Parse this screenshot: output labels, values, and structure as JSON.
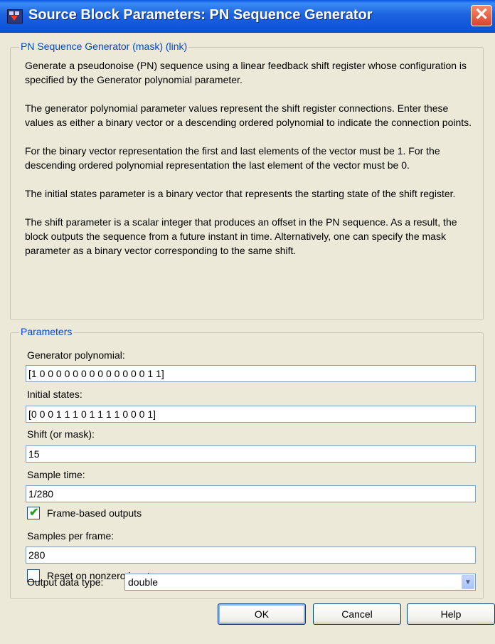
{
  "window": {
    "title": "Source Block Parameters: PN Sequence Generator",
    "close_glyph": "✕",
    "icon": "simulink-block-icon"
  },
  "description": {
    "legend": "PN Sequence Generator (mask) (link)",
    "paragraphs": [
      "Generate a pseudonoise (PN) sequence using a linear feedback shift register whose configuration is specified by the Generator polynomial parameter.",
      "The generator polynomial parameter values represent the shift register connections. Enter these values as either a binary vector or a descending ordered polynomial to indicate the connection points.",
      "For the binary vector representation the first and last elements of the vector must be 1. For the descending ordered polynomial representation the last element of the vector must be 0.",
      "The initial states parameter is a binary vector that represents the starting state of the shift register.",
      "The shift parameter is a scalar integer that produces an offset in the PN sequence. As a result, the block outputs the sequence from a future instant in time. Alternatively, one can specify the mask parameter as a binary vector corresponding to the same shift."
    ]
  },
  "parameters": {
    "legend": "Parameters",
    "generator_polynomial": {
      "label": "Generator polynomial:",
      "value": "[1 0 0 0 0 0 0 0 0 0 0 0 0 0 1 1]"
    },
    "initial_states": {
      "label": "Initial states:",
      "value": "[0 0 0 1 1 1 0 1 1 1 1 0 0 0 1]"
    },
    "shift": {
      "label": "Shift (or mask):",
      "value": "15"
    },
    "sample_time": {
      "label": "Sample time:",
      "value": "1/280"
    },
    "frame_based": {
      "label": "Frame-based outputs",
      "checked": true
    },
    "samples_per_frame": {
      "label": "Samples per frame:",
      "value": "280"
    },
    "reset_nonzero": {
      "label": "Reset on nonzero input",
      "checked": false
    },
    "output_data_type": {
      "label": "Output data type:",
      "value": "double"
    }
  },
  "buttons": {
    "ok": "OK",
    "cancel": "Cancel",
    "help": "Help"
  }
}
